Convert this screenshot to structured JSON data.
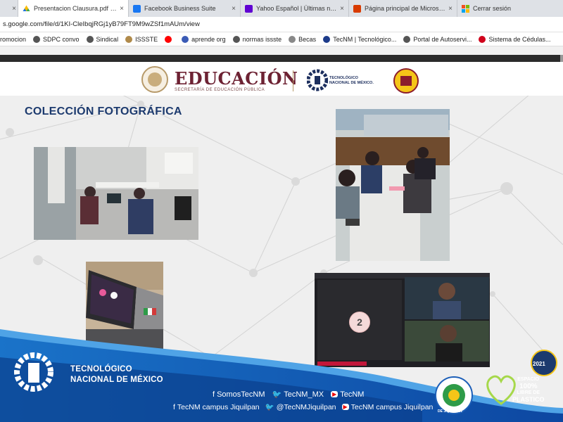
{
  "browser": {
    "tabs": [
      {
        "label": "",
        "active": false,
        "favicon": "partial-tab-icon",
        "color": "#6f6f6f"
      },
      {
        "label": "Presentacion Clausura.pdf - Go",
        "active": true,
        "favicon": "google-drive-icon",
        "color": "#1a73e8"
      },
      {
        "label": "Facebook Business Suite",
        "active": false,
        "favicon": "facebook-icon",
        "color": "#1877f2"
      },
      {
        "label": "Yahoo Español | Últimas noticias",
        "active": false,
        "favicon": "yahoo-icon",
        "color": "#6001d2"
      },
      {
        "label": "Página principal de Microsoft O",
        "active": false,
        "favicon": "office-icon",
        "color": "#d83b01"
      },
      {
        "label": "Cerrar sesión",
        "active": false,
        "favicon": "microsoft-icon",
        "color": "#00a4ef"
      }
    ],
    "close_glyph": "×",
    "address": "s.google.com/file/d/1KI-CleIbqjRGj1yB79FT9M9wZSf1mAUm/view",
    "bookmarks": [
      {
        "label": "romocion",
        "icon": "none",
        "color": ""
      },
      {
        "label": "SDPC convo",
        "icon": "globe-icon",
        "color": "#555555"
      },
      {
        "label": "Sindical",
        "icon": "globe-icon",
        "color": "#555555"
      },
      {
        "label": "ISSSTE",
        "icon": "issste-icon",
        "color": "#b08a4a"
      },
      {
        "label": "",
        "icon": "youtube-icon",
        "color": "#ff0000"
      },
      {
        "label": "aprende org",
        "icon": "aprende-icon",
        "color": "#3b5bb5"
      },
      {
        "label": "normas issste",
        "icon": "globe-icon",
        "color": "#555555"
      },
      {
        "label": "Becas",
        "icon": "becas-icon",
        "color": "#888888"
      },
      {
        "label": "TecNM | Tecnológico...",
        "icon": "tecnm-icon",
        "color": "#1d3b8a"
      },
      {
        "label": "Portal de Autoservi...",
        "icon": "globe-icon",
        "color": "#555555"
      },
      {
        "label": "Sistema de Cédulas...",
        "icon": "cedulas-icon",
        "color": "#d0021b"
      }
    ]
  },
  "slide": {
    "educacion_title": "EDUCACIÓN",
    "educacion_subtitle": "SECRETARÍA DE EDUCACIÓN PÚBLICA",
    "tecnm_header_line1": "TECNOLÓGICO",
    "tecnm_header_line2": "NACIONAL DE MÉXICO.",
    "heading": "COLECCIÓN FOTOGRÁFICA",
    "meeting_participant_number": "2",
    "footer_tecnm_line1": "TECNOLÓGICO",
    "footer_tecnm_line2": "NACIONAL DE MÉXICO",
    "social_row1": [
      {
        "icon": "facebook-icon",
        "text": "SomosTecNM"
      },
      {
        "icon": "twitter-icon",
        "text": "TecNM_MX"
      },
      {
        "icon": "youtube-icon",
        "text": "TecNM"
      }
    ],
    "social_row2": [
      {
        "icon": "facebook-icon",
        "text": "TecNM campus Jiquilpan"
      },
      {
        "icon": "twitter-icon",
        "text": "@TecNMJiquilpan"
      },
      {
        "icon": "youtube-icon",
        "text": "TecNM campus Jiquilpan"
      }
    ],
    "jiquilpan_seal_text": "DE JIQUILPAN",
    "plastic_badge_line1": "ESPACIO",
    "plastic_badge_line2": "100%",
    "plastic_badge_line3": "LIBRE DE",
    "plastic_badge_line4": "PLASTICO",
    "year_badge": "2021"
  },
  "colors": {
    "heading_blue": "#1c3a6e",
    "educacion_maroon": "#6d2233",
    "footer_blue": "#1565c0"
  }
}
